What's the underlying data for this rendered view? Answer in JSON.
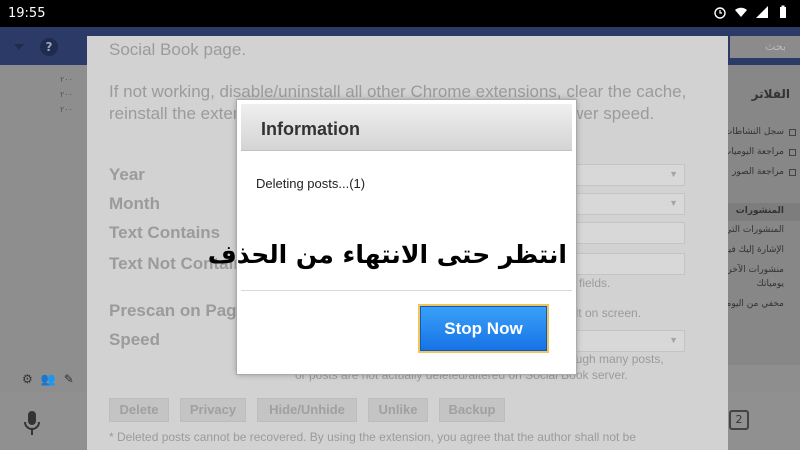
{
  "status_bar": {
    "time": "19:55",
    "icons": [
      "alarm-icon",
      "wifi-icon",
      "signal-icon",
      "battery-icon"
    ]
  },
  "facebook": {
    "search_placeholder": "بحث",
    "help": "?",
    "right_sidebar": {
      "title": "الفلاتر",
      "items": [
        "سجل النشاطات",
        "مراجعة اليوميات",
        "مراجعة الصور"
      ],
      "section": "المنشورات",
      "section_items": [
        "المنشورات التي",
        "الإشارة إليك فيها",
        "منشورات الآخرين",
        "يومياتك",
        "مخفي من اليوميات"
      ]
    },
    "left_dates": [
      "٢٠٠",
      "٢٠٠",
      "٢٠٠"
    ],
    "tab_count": "2"
  },
  "extension_panel": {
    "line1": "Social Book page.",
    "line2": "If not working, disable/uninstall all other Chrome extensions, clear the cache, reinstall the extension and try again. And you can also try a lower speed.",
    "fields": [
      {
        "label": "Year"
      },
      {
        "label": "Month"
      },
      {
        "label": "Text Contains"
      },
      {
        "label": "Text Not Contains"
      },
      {
        "label": "Prescan on Page"
      },
      {
        "label": "Speed"
      }
    ],
    "notes": {
      "fields": "fields.",
      "screen": "ult on screen.",
      "speed": "ough many posts,",
      "deleted": "or posts are not actually deleted/altered on Social Book server."
    },
    "buttons": [
      "Delete",
      "Privacy",
      "Hide/Unhide",
      "Unlike",
      "Backup"
    ],
    "footer": "* Deleted posts cannot be recovered. By using the extension, you agree that the author shall not be"
  },
  "dialog": {
    "title": "Information",
    "message": "Deleting posts...(1)",
    "overlay_text": "انتظر حتى الانتهاء من الحذف",
    "stop_button": "Stop Now",
    "colors": {
      "button": "#1f82f0",
      "button_outline": "#f1c55a"
    }
  }
}
